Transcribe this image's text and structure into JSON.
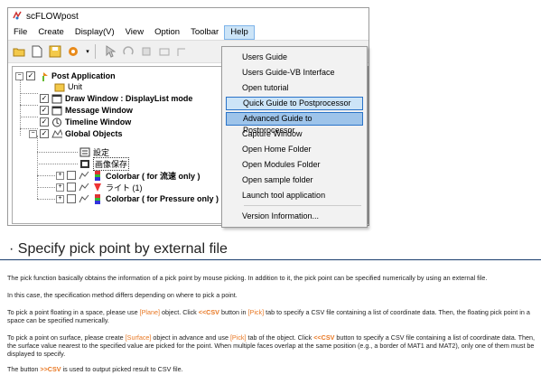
{
  "window": {
    "title": "scFLOWpost",
    "title_icon": "scflow-app-icon"
  },
  "menubar": [
    "File",
    "Create",
    "Display(V)",
    "View",
    "Option",
    "Toolbar",
    "Help"
  ],
  "active_menu": "Help",
  "toolbar_icons": [
    "open-folder-icon",
    "new-file-icon",
    "save-icon",
    "settings-icon",
    "dropdown-arrow-icon",
    "pointer-icon",
    "rotate-icon",
    "pan-icon",
    "zoom-icon",
    "fit-icon"
  ],
  "tree": {
    "root": "Post Application",
    "items": [
      {
        "label": "Unit",
        "checked": false,
        "icon": "unit-icon"
      },
      {
        "label": "Draw Window : DisplayList mode",
        "checked": true,
        "icon": "draw-window-icon",
        "bold": true
      },
      {
        "label": "Message Window",
        "checked": true,
        "icon": "message-window-icon",
        "bold": true
      },
      {
        "label": "Timeline Window",
        "checked": true,
        "icon": "timeline-icon",
        "bold": true
      },
      {
        "label": "Global Objects",
        "checked": true,
        "icon": "global-objects-icon",
        "bold": true
      },
      {
        "label": "設定",
        "icon": "settings-doc-icon"
      },
      {
        "label": "画像保存",
        "icon": "image-save-icon"
      },
      {
        "label": "Colorbar ( for 流速 only )",
        "icon": "colorbar-icon",
        "bold": true
      },
      {
        "label": "ライト (1)",
        "icon": "light-icon"
      },
      {
        "label": "Colorbar ( for Pressure only ) [Forcib",
        "icon": "colorbar-icon",
        "bold": true
      }
    ]
  },
  "help_menu": {
    "items": [
      "Users Guide",
      "Users Guide-VB Interface",
      "Open tutorial",
      "Quick Guide to Postprocessor",
      "Advanced Guide to Postprocessor",
      "Capture Window",
      "Open Home Folder",
      "Open Modules Folder",
      "Open sample folder",
      "Launch tool application",
      "Version Information..."
    ]
  },
  "document": {
    "heading": "Specify pick point by external file",
    "p1": "The pick function basically obtains the information of a pick point by mouse picking. In addition to it, the pick point can be specified numerically by using an external file.",
    "p2": "In this case, the specification method differs depending on where to pick a point.",
    "p3a": "To pick a point floating in a space, please use ",
    "p3_plane": "[Plane]",
    "p3b": " object. Click ",
    "p3_csv": "<<CSV",
    "p3c": " button in ",
    "p3_pick": "[Pick]",
    "p3d": " tab to specify a CSV file containing a list of coordinate data. Then, the floating pick point in a space can be specified numerically.",
    "p4a": "To pick a point on surface, please create ",
    "p4_surface": "[Surface]",
    "p4b": " object in advance and use ",
    "p4_pick": "[Pick]",
    "p4c": " tab of the object. Click ",
    "p4_csv": "<<CSV",
    "p4d": " button to specify a CSV file containing a list of coordinate data. Then, the surface value nearest to the specified value are picked for the point. When multiple faces overlap at the same position (e.g., a border of MAT1 and MAT2), only one of them must be displayed to specify.",
    "p5a": "The button ",
    "p5_csv": ">>CSV",
    "p5b": " is used to output picked result to CSV file."
  },
  "colors": {
    "accent_highlight": "#cce4f7",
    "accent_border": "#2a73c8",
    "keyword": "#e87722",
    "rule": "#1a3d6d"
  }
}
